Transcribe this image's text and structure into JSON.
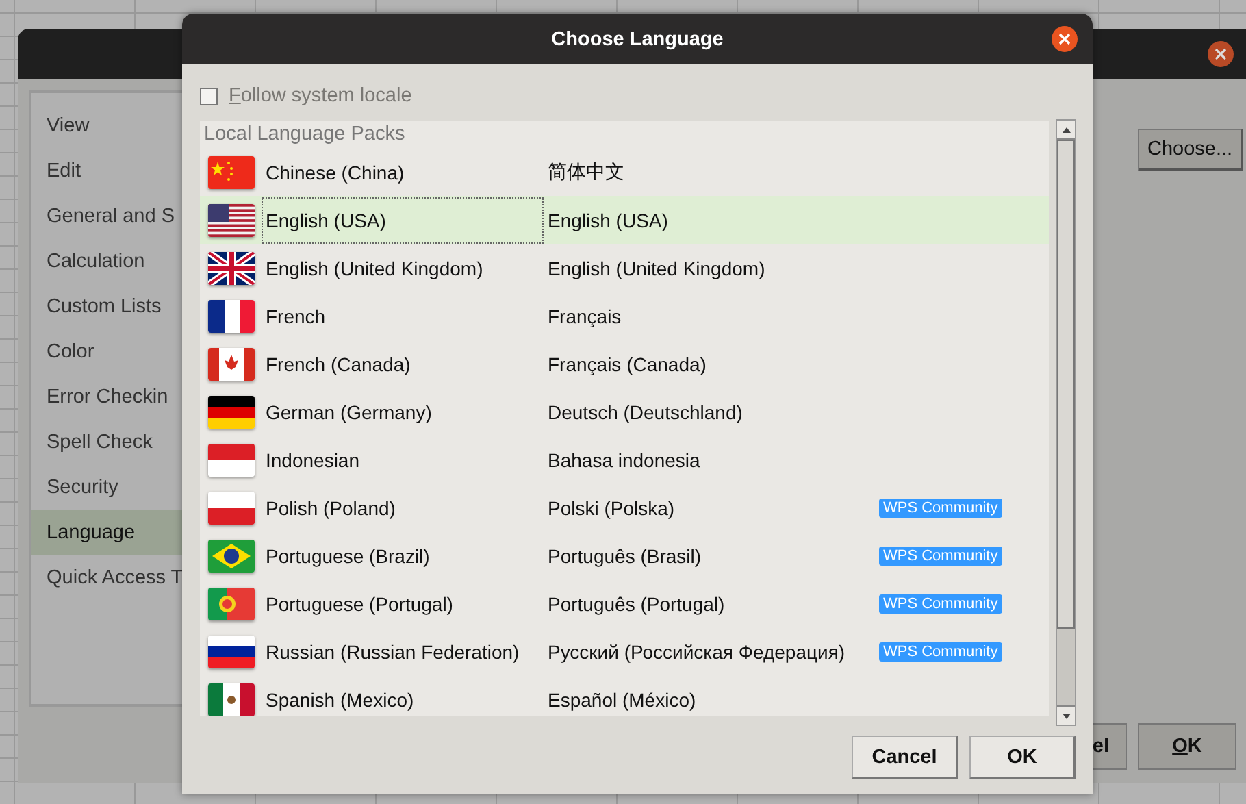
{
  "back_window": {
    "sidebar": {
      "items": [
        {
          "label": "View",
          "selected": false
        },
        {
          "label": "Edit",
          "selected": false
        },
        {
          "label": "General and S",
          "selected": false
        },
        {
          "label": "Calculation",
          "selected": false
        },
        {
          "label": "Custom Lists",
          "selected": false
        },
        {
          "label": "Color",
          "selected": false
        },
        {
          "label": "Error Checkin",
          "selected": false
        },
        {
          "label": "Spell Check",
          "selected": false
        },
        {
          "label": "Security",
          "selected": false
        },
        {
          "label": "Language",
          "selected": true
        },
        {
          "label": "Quick Access T",
          "selected": false
        }
      ]
    },
    "choose_button": "Choose...",
    "buttons": [
      "el",
      "OK"
    ]
  },
  "dialog": {
    "title": "Choose Language",
    "follow_system_locale": {
      "label": "Follow system locale",
      "checked": false
    },
    "list": {
      "header": "Local Language Packs",
      "rows": [
        {
          "name": "Chinese (China)",
          "native": "简体中文",
          "selected": false
        },
        {
          "name": "English (USA)",
          "native": "English (USA)",
          "selected": true
        },
        {
          "name": "English (United Kingdom)",
          "native": "English (United Kingdom)",
          "selected": false
        },
        {
          "name": "French",
          "native": "Français",
          "selected": false
        },
        {
          "name": "French (Canada)",
          "native": "Français (Canada)",
          "selected": false
        },
        {
          "name": "German (Germany)",
          "native": "Deutsch (Deutschland)",
          "selected": false
        },
        {
          "name": "Indonesian",
          "native": "Bahasa indonesia",
          "selected": false
        },
        {
          "name": "Polish (Poland)",
          "native": "Polski (Polska)",
          "badge": "WPS Community",
          "selected": false
        },
        {
          "name": "Portuguese (Brazil)",
          "native": "Português (Brasil)",
          "badge": "WPS Community",
          "selected": false
        },
        {
          "name": "Portuguese (Portugal)",
          "native": "Português (Portugal)",
          "badge": "WPS Community",
          "selected": false
        },
        {
          "name": "Russian (Russian Federation)",
          "native": "Русский (Российская Федерация)",
          "badge": "WPS Community",
          "selected": false
        },
        {
          "name": "Spanish (Mexico)",
          "native": "Español (México)",
          "selected": false
        }
      ]
    },
    "buttons": [
      "Cancel",
      "OK"
    ]
  }
}
